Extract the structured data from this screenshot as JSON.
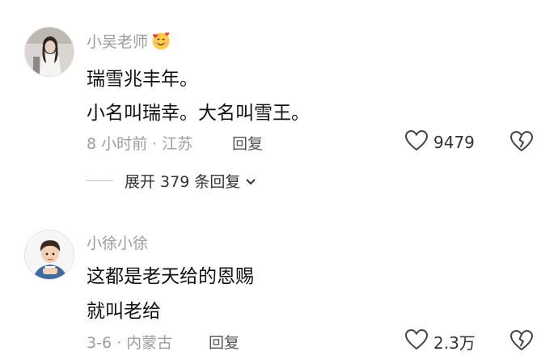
{
  "comments": [
    {
      "username": "小吴老师",
      "text_lines": [
        "瑞雪兆丰年。",
        "小名叫瑞幸。大名叫雪王。"
      ],
      "meta": "8 小时前 · 江苏",
      "reply_label": "回复",
      "like_count": "9479",
      "expand_label": "展开 379 条回复"
    },
    {
      "username": "小徐小徐",
      "text_lines": [
        "这都是老天给的恩赐",
        "就叫老给"
      ],
      "meta": "3-6 · 内蒙古",
      "reply_label": "回复",
      "like_count": "2.3万"
    }
  ],
  "icons": {
    "username_emoji": "smiling-face-with-hearts-icon",
    "like": "heart-outline-icon",
    "dislike": "broken-heart-outline-icon",
    "expand": "chevron-down-icon"
  },
  "colors": {
    "text": "#111111",
    "secondary": "#9b9b9b",
    "background": "#ffffff"
  }
}
